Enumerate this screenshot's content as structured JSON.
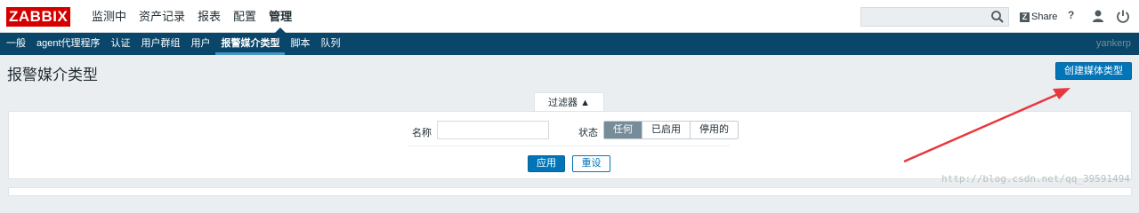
{
  "brand": {
    "logo": "ZABBIX",
    "color": "#d40000"
  },
  "main_menu": [
    {
      "label": "监测中"
    },
    {
      "label": "资产记录"
    },
    {
      "label": "报表"
    },
    {
      "label": "配置"
    },
    {
      "label": "管理",
      "active": true
    }
  ],
  "header_tools": {
    "search_placeholder": "",
    "share_label": "Share",
    "share_badge": "Z",
    "help_label": "?"
  },
  "sub_menu": [
    {
      "label": "一般"
    },
    {
      "label": "agent代理程序"
    },
    {
      "label": "认证"
    },
    {
      "label": "用户群组"
    },
    {
      "label": "用户"
    },
    {
      "label": "报警媒介类型",
      "active": true
    },
    {
      "label": "脚本"
    },
    {
      "label": "队列"
    }
  ],
  "server_name": "yankerp",
  "page": {
    "title": "报警媒介类型",
    "create_button": "创建媒体类型"
  },
  "filter": {
    "tab_label": "过滤器 ▲",
    "name_label": "名称",
    "name_value": "",
    "status_label": "状态",
    "status_options": [
      "任何",
      "已启用",
      "停用的"
    ],
    "status_selected": "任何",
    "apply_label": "应用",
    "reset_label": "重设"
  },
  "watermark": "http://blog.csdn.net/qq_39591494",
  "colors": {
    "nav_bg": "#0a466a",
    "primary": "#0275b8",
    "annotation_arrow": "#e8383d"
  }
}
